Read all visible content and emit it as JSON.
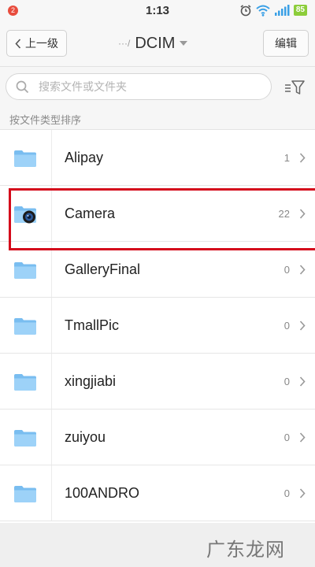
{
  "status_bar": {
    "notification_count": "2",
    "time": "1:13",
    "icons": [
      "alarm-icon",
      "wifi-icon",
      "signal-icon"
    ],
    "battery": "85"
  },
  "header": {
    "back_label": "上一级",
    "path_prefix": "···/",
    "title": "DCIM",
    "edit_label": "编辑"
  },
  "search": {
    "placeholder": "搜索文件或文件夹"
  },
  "sort_label": "按文件类型排序",
  "folders": [
    {
      "name": "Alipay",
      "count": "1",
      "icon": "folder-icon"
    },
    {
      "name": "Camera",
      "count": "22",
      "icon": "camera-folder-icon"
    },
    {
      "name": "GalleryFinal",
      "count": "0",
      "icon": "folder-icon"
    },
    {
      "name": "TmallPic",
      "count": "0",
      "icon": "folder-icon"
    },
    {
      "name": "xingjiabi",
      "count": "0",
      "icon": "folder-icon"
    },
    {
      "name": "zuiyou",
      "count": "0",
      "icon": "folder-icon"
    },
    {
      "name": "100ANDRO",
      "count": "0",
      "icon": "folder-icon"
    }
  ],
  "watermark": "广东龙网",
  "colors": {
    "highlight": "#d40a1b",
    "folder": "#8cc9f5",
    "battery": "#8ccd3a"
  }
}
